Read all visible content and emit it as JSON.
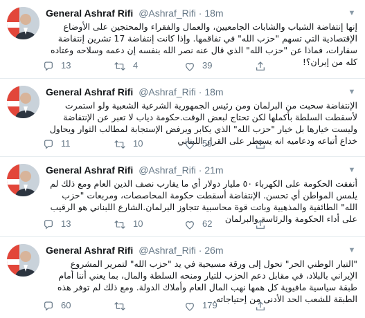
{
  "tweets": [
    {
      "author_name": "General Ashraf Rifi",
      "author_handle": "@Ashraf_Rifi",
      "separator": "·",
      "time": "18m",
      "text": "إنها إنتفاضة الشباب والشابات الجامعيين، والعمال والفقراء والمحتجين على الأوضاع الإقتصادية التي تسهم \"حزب الله\" في تفاقمها. وإذا كانت إنتفاضة 17 تشرين إنتفاضة سفارات، فماذا عن \"حزب الله\" الذي قال عنه نصر الله بنفسه إن دعمه وسلاحه وعتاده كله من إيران؟!",
      "replies": "13",
      "retweets": "4",
      "likes": "39"
    },
    {
      "author_name": "General Ashraf Rifi",
      "author_handle": "@Ashraf_Rifi",
      "separator": "·",
      "time": "18m",
      "text": "الإنتفاضة سحبت من البرلمان ومن رئيس الجمهورية الشرعية الشعبية ولو استمرت لأسقطت السلطة بأكملها لكن تحتاج لبعض الوقت.حكومة دياب لا تعبر عن الإنتفاضة وليست خيارها بل خيار \"حزب الله\" الذي يكابر ويرفض الإستجابة لمطالب الثوار ويحاول خداع أتباعه ودعاميه انه يسيطر على القرار اللبناني",
      "replies": "11",
      "retweets": "10",
      "likes": "59"
    },
    {
      "author_name": "General Ashraf Rifi",
      "author_handle": "@Ashraf_Rifi",
      "separator": "·",
      "time": "21m",
      "text": "أنفقت الحكومة على الكهرباء ٥٠ مليار دولار أي ما يقارب نصف الدين العام ومع ذلك لم يلمس المواطن أي تحسن. الإنتفاضة أسقطت حكومة المحاصصات، ومربعات \"حزب الله\" الطائفية والمذهبية وباتت قوة محاسبية تتجاوز البرلمان.الشارع اللبناني هو الرقيب على أداء الحكومة والرئاسة والبرلمان",
      "replies": "13",
      "retweets": "10",
      "likes": "62"
    },
    {
      "author_name": "General Ashraf Rifi",
      "author_handle": "@Ashraf_Rifi",
      "separator": "·",
      "time": "26m",
      "text": "\"التيار الوطني الحر\" تحول إلى ورقة مسيحية في يد \"حزب الله\" لتمرير المشروع الإيراني بالبلاد، في مقابل دعم الحزب للتيار ومنحه السلطة والمال، بما يعني أننا أمام طبقة سياسية مافيوية كل همها نهب المال العام وأملاك الدولة. ومع ذلك لم توفر هذه الطبقة للشعب الحد الأدنى من إحتياجاته.",
      "replies": "60",
      "retweets": "",
      "likes": "179"
    }
  ],
  "icons": {
    "reply": "reply-icon",
    "retweet": "retweet-icon",
    "like": "like-icon",
    "share": "share-icon",
    "menu": "chevron-down-icon"
  },
  "colors": {
    "text": "#14171a",
    "secondary": "#657786",
    "border": "#e6ecf0"
  }
}
